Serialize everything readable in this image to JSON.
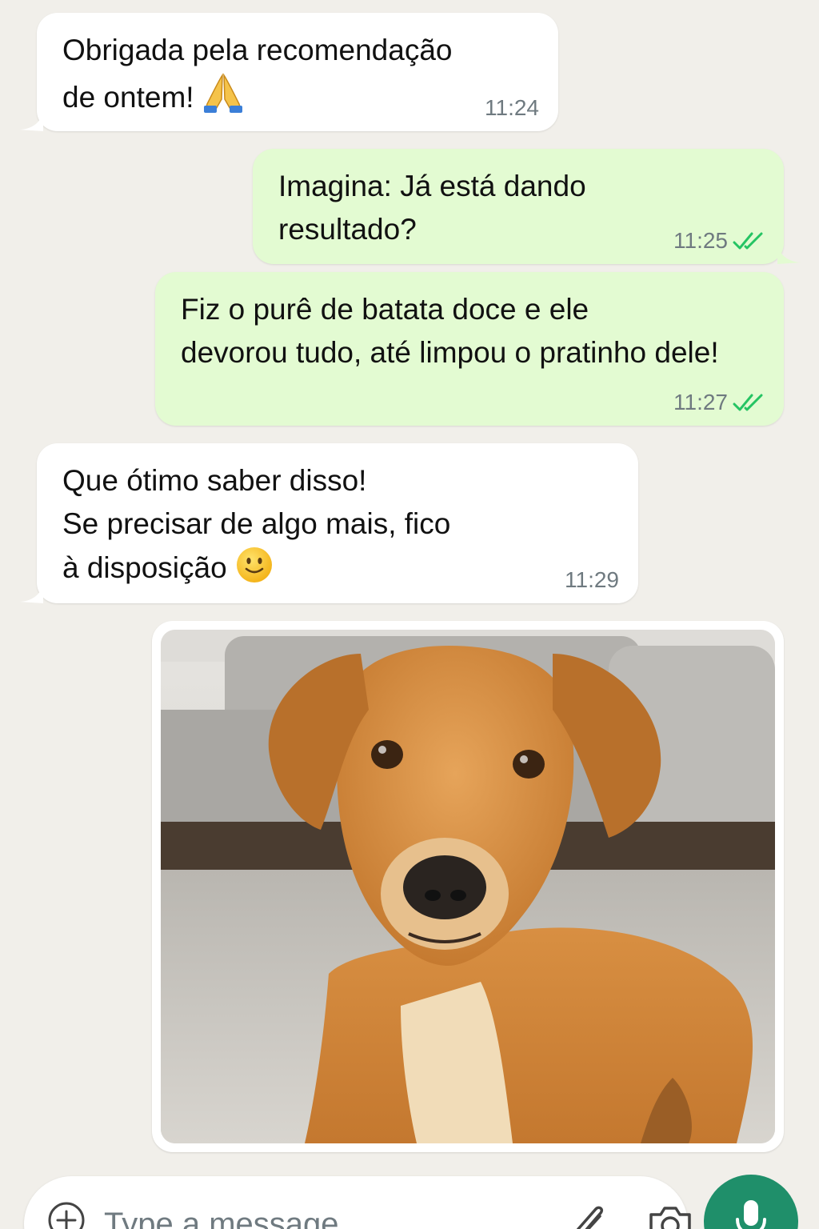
{
  "messages": [
    {
      "direction": "in",
      "lines": [
        "Obrigada pela recomendação",
        "de ontem!"
      ],
      "emoji": "folded-hands",
      "time": "11:24"
    },
    {
      "direction": "out",
      "lines": [
        "Imagina: Já está dando",
        "resultado?"
      ],
      "time": "11:25",
      "status": "read"
    },
    {
      "direction": "out",
      "lines": [
        "Fiz o purê de batata doce e ele",
        "devorou tudo, até limpou o pratinho dele!"
      ],
      "time": "11:27",
      "status": "read"
    },
    {
      "direction": "in",
      "lines": [
        "Que ótimo saber disso!",
        "Se precisar de algo mais, fico",
        "à disposição"
      ],
      "emoji": "slightly-smiling-face",
      "time": "11:29"
    }
  ],
  "image_message": {
    "subject": "dog-photo"
  },
  "composer": {
    "placeholder": "Type a message"
  },
  "colors": {
    "background": "#f1efea",
    "incoming_bubble": "#ffffff",
    "outgoing_bubble": "#e3fbd2",
    "read_ticks": "#25c463",
    "timestamp": "#6f7a80",
    "mic_button": "#1f8f6a"
  },
  "icons": [
    "folded-hands-emoji",
    "slightly-smiling-face-emoji",
    "double-check-icon",
    "plus-icon",
    "paperclip-icon",
    "camera-icon",
    "microphone-icon"
  ]
}
